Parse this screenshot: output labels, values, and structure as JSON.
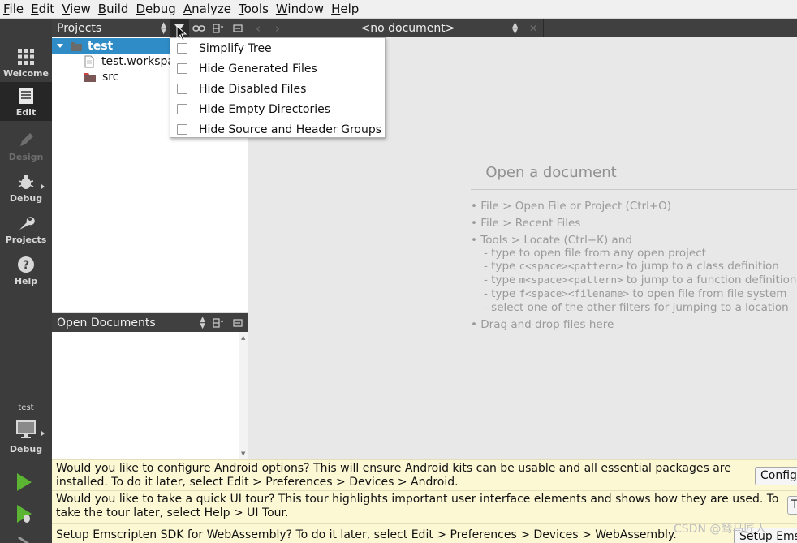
{
  "menubar": {
    "items": [
      {
        "first": "F",
        "rest": "ile"
      },
      {
        "first": "E",
        "rest": "dit"
      },
      {
        "first": "V",
        "rest": "iew"
      },
      {
        "first": "B",
        "rest": "uild"
      },
      {
        "first": "D",
        "rest": "ebug"
      },
      {
        "first": "A",
        "rest": "nalyze"
      },
      {
        "first": "T",
        "rest": "ools"
      },
      {
        "first": "W",
        "rest": "indow"
      },
      {
        "first": "H",
        "rest": "elp"
      }
    ]
  },
  "modes": {
    "welcome": "Welcome",
    "edit": "Edit",
    "design": "Design",
    "debug": "Debug",
    "projects": "Projects",
    "help": "Help"
  },
  "kit": {
    "project": "test",
    "mode": "Debug"
  },
  "projects_pane": {
    "title": "Projects",
    "tree": [
      "test",
      "test.workspa",
      "src"
    ]
  },
  "editor": {
    "document_selector": "<no document>",
    "open_title": "Open a document",
    "hints": {
      "h1": "• File > Open File or Project (Ctrl+O)",
      "h2": "• File > Recent Files",
      "h3": "• Tools > Locate (Ctrl+K) and",
      "s1": "- type to open file from any open project",
      "s2a": "- type ",
      "s2m": "c<space><pattern>",
      "s2b": " to jump to a class definition",
      "s3a": "- type ",
      "s3m": "m<space><pattern>",
      "s3b": " to jump to a function definition",
      "s4a": "- type ",
      "s4m": "f<space><filename>",
      "s4b": " to open file from file system",
      "s5": "- select one of the other filters for jumping to a location",
      "h4": "• Drag and drop files here"
    }
  },
  "open_documents": {
    "title": "Open Documents"
  },
  "filter_menu": {
    "items": [
      "Simplify Tree",
      "Hide Generated Files",
      "Hide Disabled Files",
      "Hide Empty Directories",
      "Hide Source and Header Groups"
    ]
  },
  "info_bars": {
    "android": {
      "text": "Would you like to configure Android options? This will ensure Android kits can be usable and all essential packages are installed. To do it later, select Edit > Preferences > Devices > Android.",
      "button": "Configu"
    },
    "tour": {
      "text": "Would you like to take a quick UI tour? This tour highlights important user interface elements and shows how they are used. To take the tour later, select Help > UI Tour.",
      "button": "T"
    },
    "emscripten": {
      "text": "Setup Emscripten SDK for WebAssembly? To do it later, select Edit > Preferences > Devices > WebAssembly.",
      "button": "Setup Ems"
    }
  },
  "watermark": "CSDN @驽马匠人"
}
